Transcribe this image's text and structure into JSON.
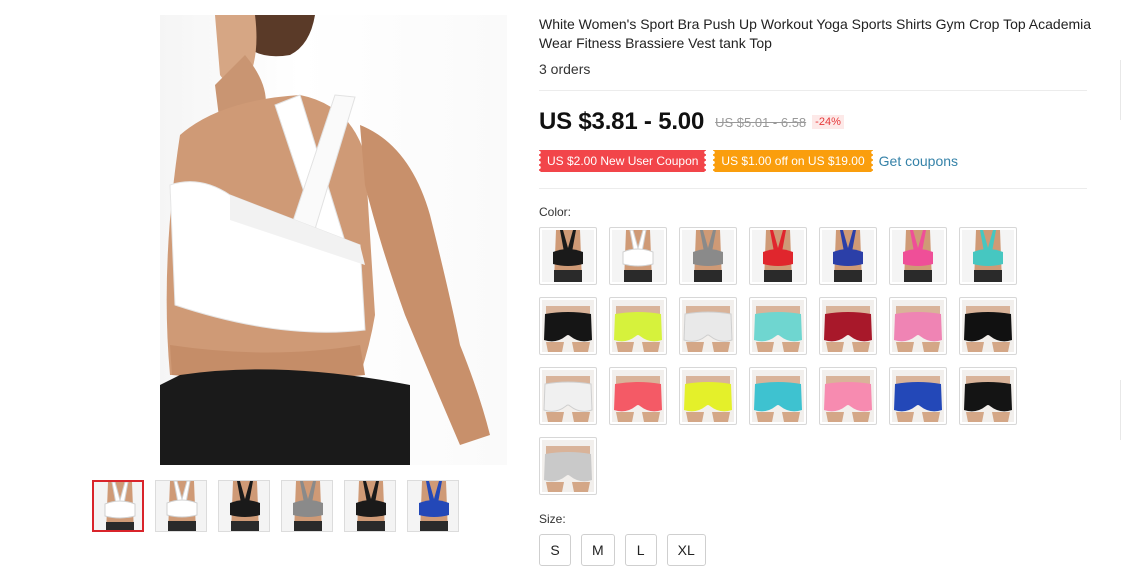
{
  "product": {
    "title": "White Women's Sport Bra Push Up Workout Yoga Sports Shirts Gym Crop Top Academia Wear Fitness Brassiere Vest tank Top",
    "orders": "3 orders"
  },
  "price": {
    "current": "US $3.81 - 5.00",
    "original": "US $5.01 - 6.58",
    "discount": "-24%"
  },
  "coupons": {
    "new_user": "US $2.00 New User Coupon",
    "spend_save": "US $1.00 off on US $19.00",
    "get_link": "Get coupons",
    "colors": {
      "red": "#f2454a",
      "orange": "#fa9e0d",
      "link": "#3582a8"
    }
  },
  "color": {
    "label": "Color:",
    "swatches": [
      {
        "kind": "bra",
        "color": "#1a1a1a"
      },
      {
        "kind": "bra",
        "color": "#ffffff"
      },
      {
        "kind": "bra",
        "color": "#8a8a8a"
      },
      {
        "kind": "bra",
        "color": "#e0262d"
      },
      {
        "kind": "bra",
        "color": "#2b3fa8"
      },
      {
        "kind": "bra",
        "color": "#ef4f98"
      },
      {
        "kind": "bra",
        "color": "#46c7c1"
      },
      {
        "kind": "shorts",
        "color": "#151515"
      },
      {
        "kind": "shorts",
        "color": "#d6f23c"
      },
      {
        "kind": "shorts",
        "color": "#e9e9e9"
      },
      {
        "kind": "shorts",
        "color": "#6fd6d0"
      },
      {
        "kind": "shorts",
        "color": "#a8182a"
      },
      {
        "kind": "shorts",
        "color": "#ef84b4"
      },
      {
        "kind": "shorts",
        "color": "#111111"
      },
      {
        "kind": "shorts",
        "color": "#f0f0f0"
      },
      {
        "kind": "shorts",
        "color": "#f45a66"
      },
      {
        "kind": "shorts",
        "color": "#e4f02a"
      },
      {
        "kind": "shorts",
        "color": "#3ec2d0"
      },
      {
        "kind": "shorts",
        "color": "#f78bb0"
      },
      {
        "kind": "shorts",
        "color": "#2348b8"
      },
      {
        "kind": "shorts",
        "color": "#141414"
      },
      {
        "kind": "shorts",
        "color": "#c9c9c9"
      }
    ]
  },
  "size": {
    "label": "Size:",
    "options": [
      "S",
      "M",
      "L",
      "XL"
    ]
  },
  "gallery": {
    "thumbs": [
      {
        "color": "#ffffff"
      },
      {
        "color": "#ffffff"
      },
      {
        "color": "#1a1a1a"
      },
      {
        "color": "#8a8a8a"
      },
      {
        "color": "#1a1a1a"
      },
      {
        "color": "#2348b8"
      }
    ]
  }
}
